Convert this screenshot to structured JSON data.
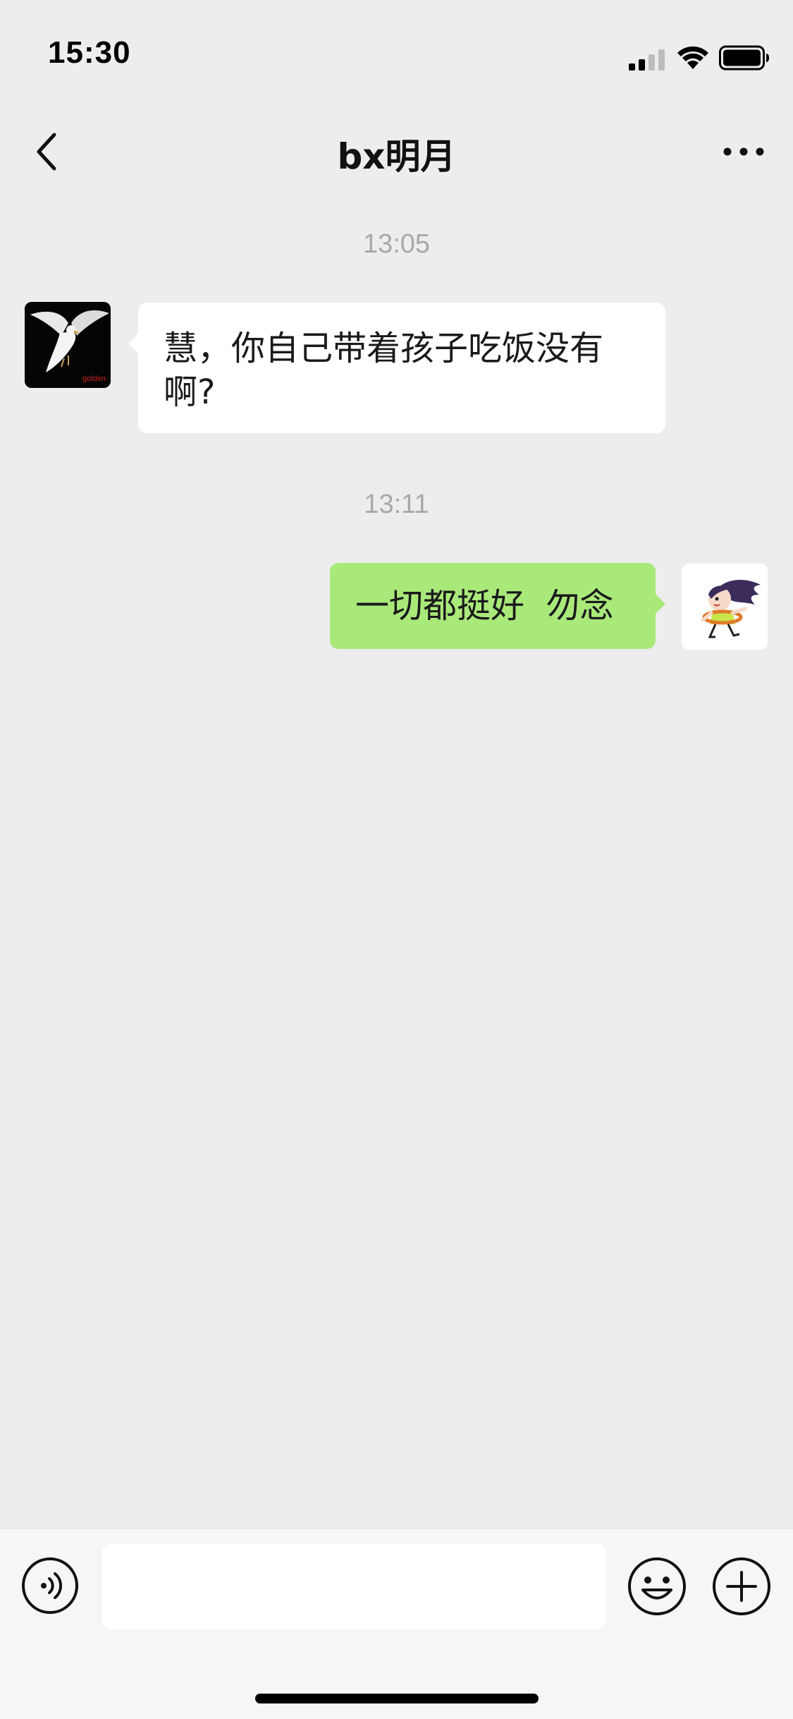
{
  "status_bar": {
    "time": "15:30",
    "signal_icon": "cellular-signal-icon",
    "wifi_icon": "wifi-icon",
    "battery_icon": "battery-icon"
  },
  "nav": {
    "title": "bx明月",
    "back_icon": "chevron-left-icon",
    "more_icon": "more-dots-icon"
  },
  "messages": [
    {
      "timestamp": "13:05",
      "direction": "incoming",
      "avatar": "white-dove-avatar",
      "avatar_text": "golden",
      "line1": "慧，你自己带着孩子吃饭没有",
      "line2": "啊?"
    },
    {
      "timestamp": "13:11",
      "direction": "outgoing",
      "avatar": "cartoon-girl-avatar",
      "text": "一切都挺好  勿念"
    }
  ],
  "input_bar": {
    "placeholder": "",
    "voice_icon": "voice-icon",
    "emoji_icon": "emoji-icon",
    "plus_icon": "plus-icon"
  },
  "colors": {
    "background": "#ededed",
    "incoming_bubble": "#ffffff",
    "outgoing_bubble": "#a9e97a",
    "timestamp": "#a8a8a8"
  }
}
